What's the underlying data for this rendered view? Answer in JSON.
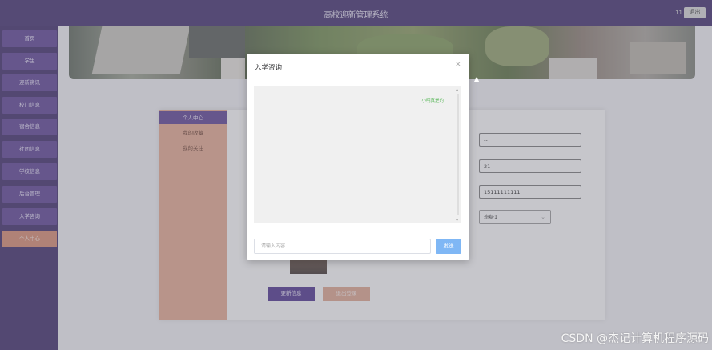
{
  "header": {
    "title": "高校迎新管理系统",
    "user": "11",
    "logout_label": "退出"
  },
  "sidebar": {
    "items": [
      {
        "label": "首页"
      },
      {
        "label": "学生"
      },
      {
        "label": "迎新资讯"
      },
      {
        "label": "校门信息"
      },
      {
        "label": "宿舍信息"
      },
      {
        "label": "社团信息"
      },
      {
        "label": "学校信息"
      },
      {
        "label": "后台管理"
      },
      {
        "label": "入学咨询"
      },
      {
        "label": "个人中心"
      }
    ],
    "active_index": 9
  },
  "profile": {
    "menu": [
      {
        "label": "个人中心"
      },
      {
        "label": "我的收藏"
      },
      {
        "label": "我的关注"
      }
    ],
    "fields": [
      {
        "value": "--"
      },
      {
        "value": "21"
      },
      {
        "value": "15111111111"
      }
    ],
    "class_select": "班级1",
    "update_label": "更新信息",
    "quit_label": "退出登录"
  },
  "modal": {
    "title": "入学咨询",
    "close": "×",
    "message": "小明真是的",
    "input_placeholder": "请输入内容",
    "send_label": "发送"
  },
  "watermark": "CSDN @杰记计算机程序源码",
  "colors": {
    "topbar": "#3d2a6b",
    "sidebar": "#3a2766",
    "nav_item": "#5b3f93",
    "nav_active": "#d98b6e",
    "send_button": "#7fb7f5"
  }
}
